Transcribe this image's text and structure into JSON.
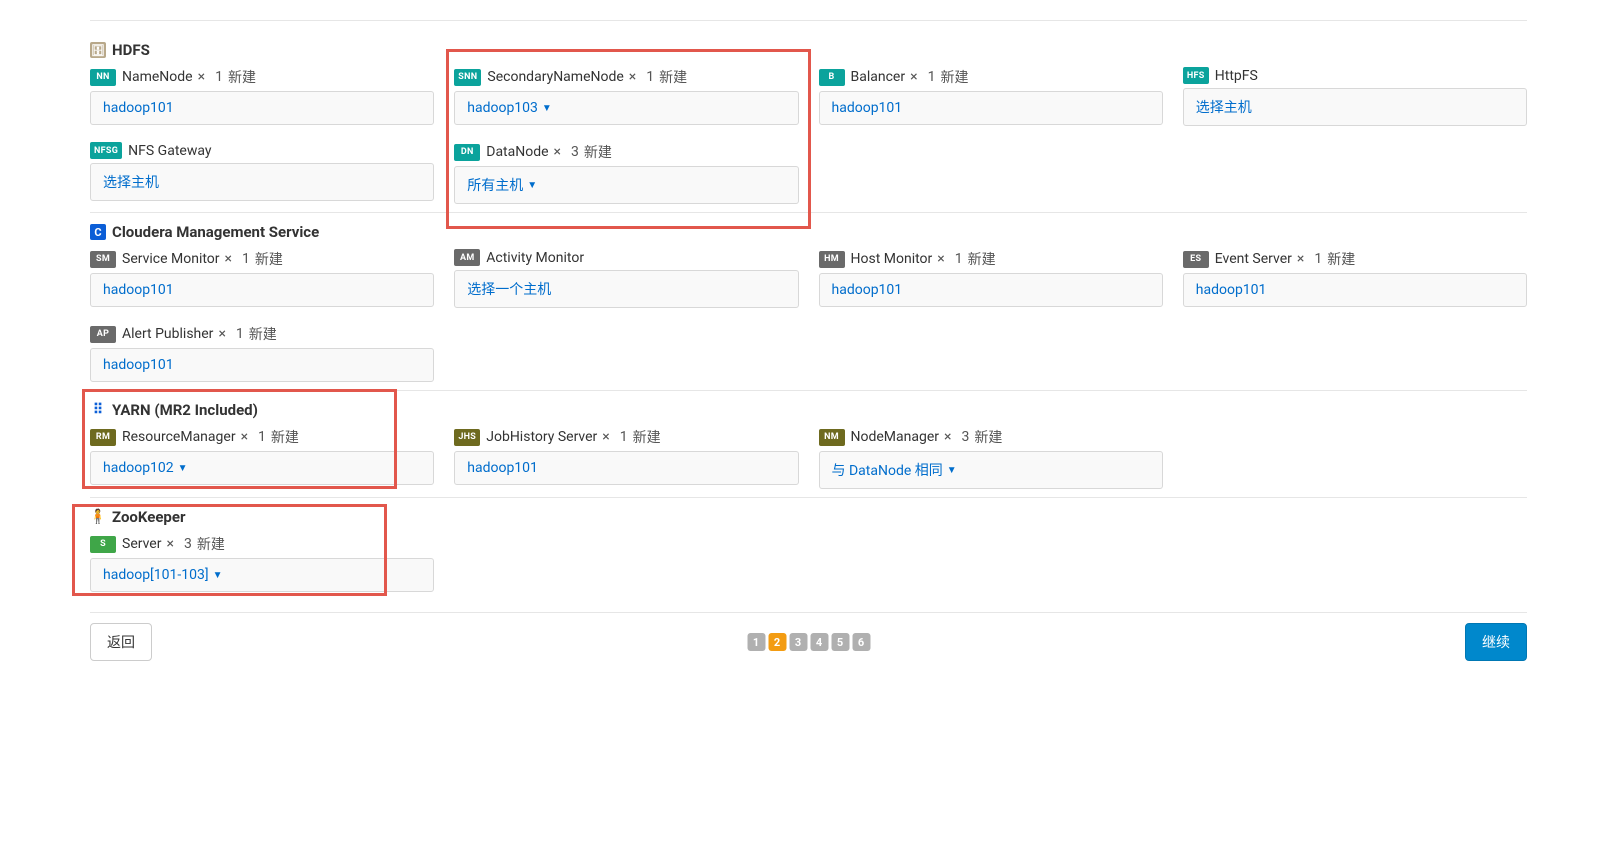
{
  "sections": {
    "hdfs": {
      "title": "HDFS",
      "roles": {
        "namenode": {
          "badge": "NN",
          "name": "NameNode",
          "count": "1",
          "suffix": "新建",
          "host": "hadoop101",
          "caret": false
        },
        "snn": {
          "badge": "SNN",
          "name": "SecondaryNameNode",
          "count": "1",
          "suffix": "新建",
          "host": "hadoop103",
          "caret": true
        },
        "balancer": {
          "badge": "B",
          "name": "Balancer",
          "count": "1",
          "suffix": "新建",
          "host": "hadoop101",
          "caret": false
        },
        "httpfs": {
          "badge": "HFS",
          "name": "HttpFS",
          "count": "",
          "suffix": "",
          "host": "选择主机",
          "caret": false
        },
        "nfsgw": {
          "badge": "NFSG",
          "name": "NFS Gateway",
          "count": "",
          "suffix": "",
          "host": "选择主机",
          "caret": false
        },
        "datanode": {
          "badge": "DN",
          "name": "DataNode",
          "count": "3",
          "suffix": "新建",
          "host": "所有主机",
          "caret": true
        }
      }
    },
    "cms": {
      "title": "Cloudera Management Service",
      "roles": {
        "sm": {
          "badge": "SM",
          "name": "Service Monitor",
          "count": "1",
          "suffix": "新建",
          "host": "hadoop101",
          "caret": false
        },
        "am": {
          "badge": "AM",
          "name": "Activity Monitor",
          "count": "",
          "suffix": "",
          "host": "选择一个主机",
          "caret": false
        },
        "hm": {
          "badge": "HM",
          "name": "Host Monitor",
          "count": "1",
          "suffix": "新建",
          "host": "hadoop101",
          "caret": false
        },
        "es": {
          "badge": "ES",
          "name": "Event Server",
          "count": "1",
          "suffix": "新建",
          "host": "hadoop101",
          "caret": false
        },
        "ap": {
          "badge": "AP",
          "name": "Alert Publisher",
          "count": "1",
          "suffix": "新建",
          "host": "hadoop101",
          "caret": false
        }
      }
    },
    "yarn": {
      "title": "YARN (MR2 Included)",
      "roles": {
        "rm": {
          "badge": "RM",
          "name": "ResourceManager",
          "count": "1",
          "suffix": "新建",
          "host": "hadoop102",
          "caret": true
        },
        "jhs": {
          "badge": "JHS",
          "name": "JobHistory Server",
          "count": "1",
          "suffix": "新建",
          "host": "hadoop101",
          "caret": false
        },
        "nm": {
          "badge": "NM",
          "name": "NodeManager",
          "count": "3",
          "suffix": "新建",
          "host": "与 DataNode 相同",
          "caret": true
        }
      }
    },
    "zk": {
      "title": "ZooKeeper",
      "roles": {
        "server": {
          "badge": "S",
          "name": "Server",
          "count": "3",
          "suffix": "新建",
          "host": "hadoop[101-103]",
          "caret": true
        }
      }
    }
  },
  "symbols": {
    "times": "×"
  },
  "pager": {
    "pages": [
      "1",
      "2",
      "3",
      "4",
      "5",
      "6"
    ],
    "active": "2"
  },
  "buttons": {
    "back": "返回",
    "continue": "继续"
  }
}
